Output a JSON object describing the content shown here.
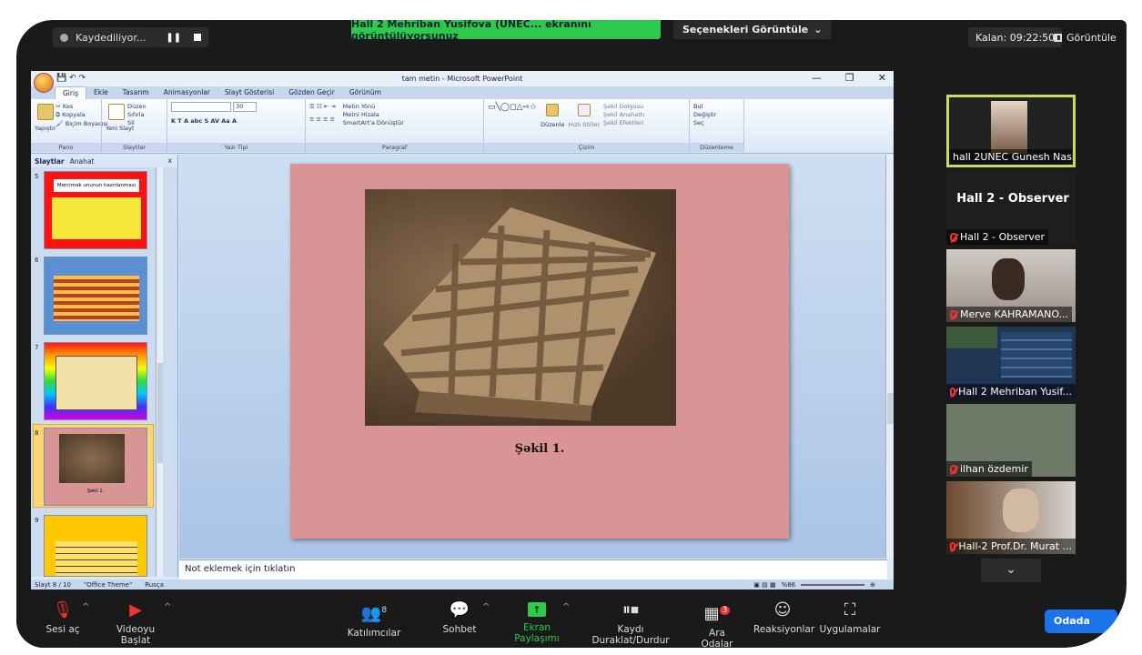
{
  "zoom_top": {
    "recording": "Kaydediliyor...",
    "pause_glyph": "❚❚",
    "share_banner": "Hall 2 Mehriban Yusifova (UNEC... ekranını görüntülüyorsunuz",
    "view_options": "Seçenekleri Görüntüle",
    "view_options_chevron": "⌄",
    "remaining": "Kalan: 09:22:50",
    "view": "Görüntüle"
  },
  "ppt": {
    "title": "tam metin - Microsoft PowerPoint",
    "min": "—",
    "max": "❐",
    "close": "✕",
    "tabs": [
      "Giriş",
      "Ekle",
      "Tasarım",
      "Animasyonlar",
      "Slayt Gösterisi",
      "Gözden Geçir",
      "Görünüm"
    ],
    "ribbon": {
      "pano": {
        "label": "Pano",
        "paste": "Yapıştır",
        "cut": "Kes",
        "copy": "Kopyala",
        "format_painter": "Biçim Boyacısı"
      },
      "slaytlar": {
        "label": "Slaytlar",
        "new_slide": "Yeni Slayt",
        "layout": "Düzen",
        "reset": "Sıfırla",
        "delete": "Sil"
      },
      "yazi": {
        "label": "Yazı Tipi",
        "size": "30"
      },
      "paragraf": {
        "label": "Paragraf",
        "text_dir": "Metin Yönü",
        "align_text": "Metni Hizala",
        "smartart": "SmartArt'a Dönüştür"
      },
      "cizim": {
        "label": "Çizim",
        "arrange": "Düzenle",
        "quick_styles": "Hızlı Stiller",
        "fill": "Şekil Dolgusu",
        "outline": "Şekil Anahattı",
        "effects": "Şekil Efektleri"
      },
      "duzenleme": {
        "label": "Düzenleme",
        "find": "Bul",
        "replace": "Değiştir",
        "select": "Seç"
      }
    },
    "left_tabs": {
      "slides": "Slaytlar",
      "outline": "Anahat"
    },
    "thumbs": [
      {
        "num": "5",
        "title": "Mercimək ununun hazırlanması"
      },
      {
        "num": "6"
      },
      {
        "num": "7"
      },
      {
        "num": "8",
        "caption": "Şəkil 1."
      },
      {
        "num": "9"
      }
    ],
    "slide": {
      "caption": "Şəkil 1."
    },
    "notes": "Not eklemek için tıklatın",
    "status": {
      "slide": "Slayt 8 / 10",
      "theme": "\"Office Theme\"",
      "lang": "Rusça",
      "zoom": "%86"
    }
  },
  "participants": [
    {
      "name": "hall 2UNEC Gunesh Nasr..."
    },
    {
      "big": "Hall 2 - Observer",
      "name": "Hall 2 - Observer"
    },
    {
      "name": "Merve KAHRAMANO..."
    },
    {
      "name": "Hall 2 Mehriban Yusif..."
    },
    {
      "name": "ilhan özdemir"
    },
    {
      "name": "Hall-2 Prof.Dr. Murat ..."
    }
  ],
  "panel_chevron": "⌄",
  "bottom": {
    "unmute": "Sesi aç",
    "start_video": "Videoyu Başlat",
    "participants": "Katılımcılar",
    "participant_count": "8",
    "chat": "Sohbet",
    "share": "Ekran Paylaşımı",
    "rec": "Kaydı Duraklat/Durdur",
    "breakout": "Ara Odalar",
    "breakout_count": "3",
    "reactions": "Reaksiyonlar",
    "apps": "Uygulamalar",
    "room": "Odada"
  },
  "colors": {
    "share_green": "#2ec84c",
    "zoom_bg": "#1a1a1a",
    "slide_pink": "#d99595",
    "accent_blue": "#1a73e8"
  }
}
